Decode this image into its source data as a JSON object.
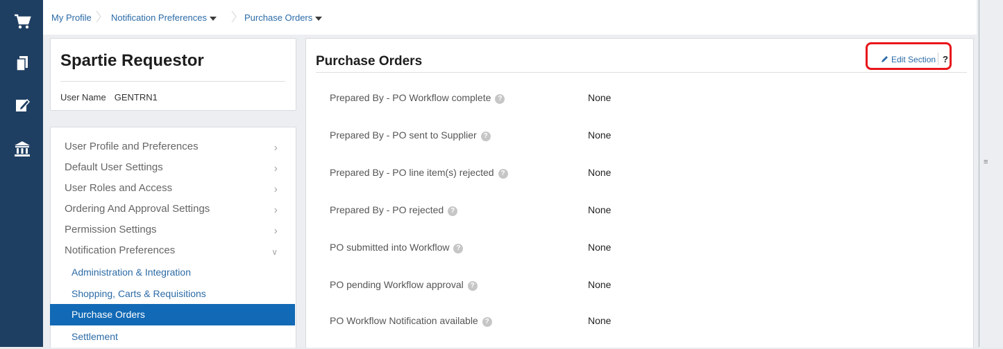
{
  "rail": {
    "icons": [
      "cart-icon",
      "documents-icon",
      "edit-document-icon",
      "bank-icon"
    ]
  },
  "breadcrumb": {
    "items": [
      "My Profile",
      "Notification Preferences",
      "Purchase Orders"
    ]
  },
  "profile": {
    "name": "Spartie Requestor",
    "username_label": "User Name",
    "username_value": "GENTRN1"
  },
  "menu": {
    "items": [
      "User Profile and Preferences",
      "Default User Settings",
      "User Roles and Access",
      "Ordering And Approval Settings",
      "Permission Settings",
      "Notification Preferences"
    ],
    "sub_items": [
      "Administration & Integration",
      "Shopping, Carts & Requisitions",
      "Purchase Orders",
      "Settlement"
    ]
  },
  "panel": {
    "title": "Purchase Orders",
    "edit_label": "Edit Section",
    "help_label": "?",
    "rows": [
      {
        "label": "Prepared By - PO Workflow complete",
        "value": "None"
      },
      {
        "label": "Prepared By - PO sent to Supplier",
        "value": "None"
      },
      {
        "label": "Prepared By - PO line item(s) rejected",
        "value": "None"
      },
      {
        "label": "Prepared By - PO rejected",
        "value": "None"
      },
      {
        "label": "PO submitted into Workflow",
        "value": "None"
      },
      {
        "label": "PO pending Workflow approval",
        "value": "None"
      },
      {
        "label": "PO Workflow Notification available",
        "value": "None"
      }
    ]
  },
  "colors": {
    "rail": "#1f3f62",
    "link": "#2a6aa7",
    "active": "#1269b5",
    "highlight_box": "#e8151b"
  }
}
